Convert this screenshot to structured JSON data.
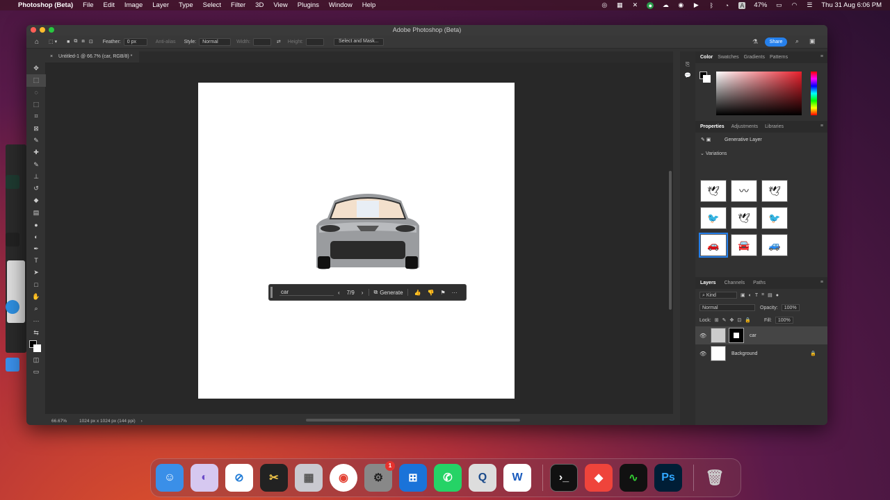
{
  "menubar": {
    "apple": "",
    "app_name": "Photoshop (Beta)",
    "items": [
      "File",
      "Edit",
      "Image",
      "Layer",
      "Type",
      "Select",
      "Filter",
      "3D",
      "View",
      "Plugins",
      "Window",
      "Help"
    ],
    "battery": "47%",
    "datetime": "Thu 31 Aug  6:06 PM",
    "input_badge": "A"
  },
  "window": {
    "title": "Adobe Photoshop (Beta)",
    "tab": "Untitled-1 @ 66.7% (car, RGB/8) *"
  },
  "options": {
    "feather_label": "Feather:",
    "feather_value": "0 px",
    "anti_alias": "Anti-alias",
    "style_label": "Style:",
    "style_value": "Normal",
    "width_label": "Width:",
    "height_label": "Height:",
    "select_mask": "Select and Mask...",
    "share": "Share"
  },
  "contextbar": {
    "prompt": "car",
    "counter": "7/9",
    "generate": "Generate"
  },
  "status": {
    "zoom": "66.67%",
    "doc_info": "1024 px x 1024 px (144 ppi)"
  },
  "color_panel": {
    "tabs": [
      "Color",
      "Swatches",
      "Gradients",
      "Patterns"
    ]
  },
  "properties_panel": {
    "tabs": [
      "Properties",
      "Adjustments",
      "Libraries"
    ],
    "layer_type": "Generative Layer",
    "variations_label": "Variations"
  },
  "layers_panel": {
    "tabs": [
      "Layers",
      "Channels",
      "Paths"
    ],
    "kind": "Kind",
    "blend_mode": "Normal",
    "opacity_label": "Opacity:",
    "opacity_value": "100%",
    "lock_label": "Lock:",
    "fill_label": "Fill:",
    "fill_value": "100%",
    "layers": [
      {
        "name": "car"
      },
      {
        "name": "Background"
      }
    ]
  },
  "dock": {
    "settings_badge": "1",
    "ps_label": "Ps",
    "word_label": "W"
  }
}
